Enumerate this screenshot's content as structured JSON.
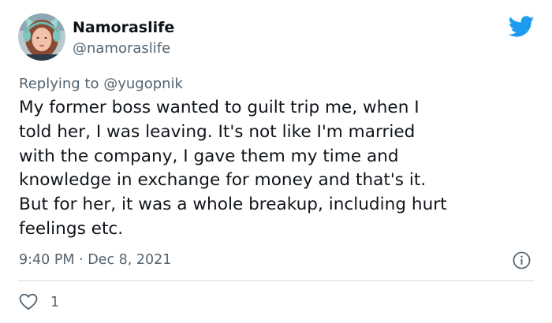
{
  "tweet": {
    "author": {
      "display_name": "Namoraslife",
      "handle": "@namoraslife",
      "avatar": "avatar-photo"
    },
    "brand_icon": "twitter-bird-icon",
    "reply": {
      "prefix": "Replying to ",
      "mention": "@yugopnik"
    },
    "text": "My former boss wanted to guilt trip me, when I\ntold her, I was leaving. It's not like I'm married\nwith the company, I gave them my time and\nknowledge in exchange for money and that's it.\nBut for her, it was a whole breakup, including hurt\nfeelings etc.",
    "timestamp": "9:40 PM · Dec 8, 2021",
    "info_icon": "info-icon",
    "like": {
      "icon": "heart-icon",
      "count": "1"
    }
  },
  "colors": {
    "text_primary": "#0f1419",
    "text_secondary": "#536471",
    "twitter_blue": "#1d9bf0",
    "divider": "#cfd9de"
  }
}
